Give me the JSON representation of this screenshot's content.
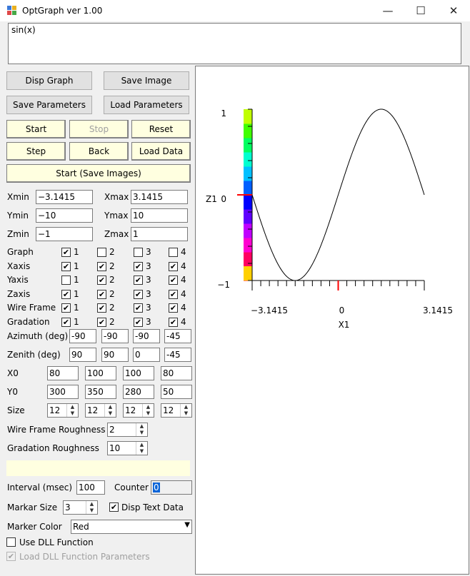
{
  "window": {
    "title": "OptGraph   ver 1.00",
    "minimize": "—",
    "maximize": "☐",
    "close": "✕"
  },
  "formula": "sin(x)",
  "buttons": {
    "disp_graph": "Disp Graph",
    "save_image": "Save Image",
    "save_parameters": "Save Parameters",
    "load_parameters": "Load Parameters",
    "start": "Start",
    "stop": "Stop",
    "reset": "Reset",
    "step": "Step",
    "back": "Back",
    "load_data": "Load Data",
    "start_save_images": "Start (Save Images)"
  },
  "ranges": {
    "xmin_label": "Xmin",
    "xmin": "−3.1415",
    "xmax_label": "Xmax",
    "xmax": "3.1415",
    "ymin_label": "Ymin",
    "ymin": "−10",
    "ymax_label": "Ymax",
    "ymax": "10",
    "zmin_label": "Zmin",
    "zmin": "−1",
    "zmax_label": "Zmax",
    "zmax": "1"
  },
  "check_grid": {
    "col_labels": [
      "1",
      "2",
      "3",
      "4"
    ],
    "rows": [
      {
        "label": "Graph",
        "checked": [
          true,
          false,
          false,
          false
        ]
      },
      {
        "label": "Xaxis",
        "checked": [
          true,
          true,
          true,
          true
        ]
      },
      {
        "label": "Yaxis",
        "checked": [
          false,
          true,
          true,
          true
        ]
      },
      {
        "label": "Zaxis",
        "checked": [
          true,
          true,
          true,
          true
        ]
      },
      {
        "label": "Wire Frame",
        "checked": [
          true,
          true,
          true,
          true
        ]
      },
      {
        "label": "Gradation",
        "checked": [
          true,
          true,
          true,
          true
        ]
      }
    ]
  },
  "view": {
    "azimuth_label": "Azimuth (deg)",
    "azimuth": [
      "-90",
      "-90",
      "-90",
      "-45"
    ],
    "zenith_label": "Zenith (deg)",
    "zenith": [
      "90",
      "90",
      "0",
      "-45"
    ],
    "x0_label": "X0",
    "x0": [
      "80",
      "100",
      "100",
      "80"
    ],
    "y0_label": "Y0",
    "y0": [
      "300",
      "350",
      "280",
      "50"
    ],
    "size_label": "Size",
    "size": [
      "12",
      "12",
      "12",
      "12"
    ]
  },
  "roughness": {
    "wire_label": "Wire Frame Roughness",
    "wire": "2",
    "grad_label": "Gradation Roughness",
    "grad": "10"
  },
  "status_text": "",
  "interval_label": "Interval (msec)",
  "interval": "100",
  "counter_label": "Counter",
  "counter": "0",
  "marker": {
    "size_label": "Markar Size",
    "size": "3",
    "disp_text_label": "Disp Text Data",
    "disp_text_checked": true,
    "color_label": "Marker Color",
    "color": "Red"
  },
  "dll": {
    "use_label": "Use DLL Function",
    "use_checked": false,
    "load_label": "Load DLL Function Parameters",
    "load_checked": true
  },
  "graph": {
    "z_axis_name": "Z1",
    "x_axis_name": "X1",
    "z_ticks": [
      "1",
      "0",
      "−1"
    ],
    "x_ticks": [
      "−3.1415",
      "0",
      "3.1415"
    ],
    "colors": {
      "curve": "#000000",
      "marker": "#ff0000"
    }
  },
  "chart_data": {
    "type": "line",
    "function": "sin(x)",
    "xlabel": "X1",
    "ylabel": "Z1",
    "xlim": [
      -3.1415,
      3.1415
    ],
    "ylim": [
      -1,
      1
    ],
    "x_tick_labels": [
      "−3.1415",
      "0",
      "3.1415"
    ],
    "y_tick_labels": [
      "−1",
      "0",
      "1"
    ],
    "marker_x": 0
  }
}
